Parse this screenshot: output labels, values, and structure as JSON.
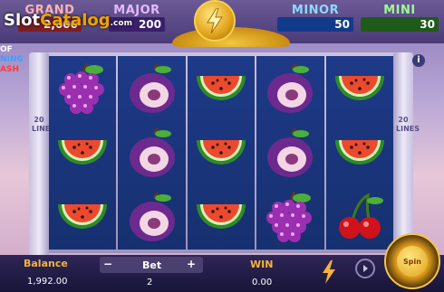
{
  "watermark": {
    "part1": "Slot",
    "part2": "Catalog",
    "suffix": ".com"
  },
  "jackpots": {
    "grand": {
      "label": "GRAND",
      "value": "2,000"
    },
    "major": {
      "label": "MAJOR",
      "value": "200"
    },
    "minor": {
      "label": "MINOR",
      "value": "50"
    },
    "mini": {
      "label": "MINI",
      "value": "30"
    }
  },
  "logo": {
    "line1": "OF",
    "line2": "NING",
    "line3": "ASH"
  },
  "lines_label": "20 LINES",
  "info_label": "i",
  "reels": [
    [
      "grapes",
      "watermelon",
      "watermelon"
    ],
    [
      "plum",
      "plum",
      "plum"
    ],
    [
      "watermelon",
      "watermelon",
      "watermelon"
    ],
    [
      "plum",
      "plum",
      "grapes"
    ],
    [
      "watermelon",
      "watermelon",
      "cherries"
    ]
  ],
  "bottom": {
    "balance_label": "Balance",
    "balance_value": "1,992.00",
    "bet_minus": "−",
    "bet_label": "Bet",
    "bet_plus": "+",
    "bet_value": "2",
    "win_label": "WIN",
    "win_value": "0.00"
  },
  "spin_label": "Spin"
}
